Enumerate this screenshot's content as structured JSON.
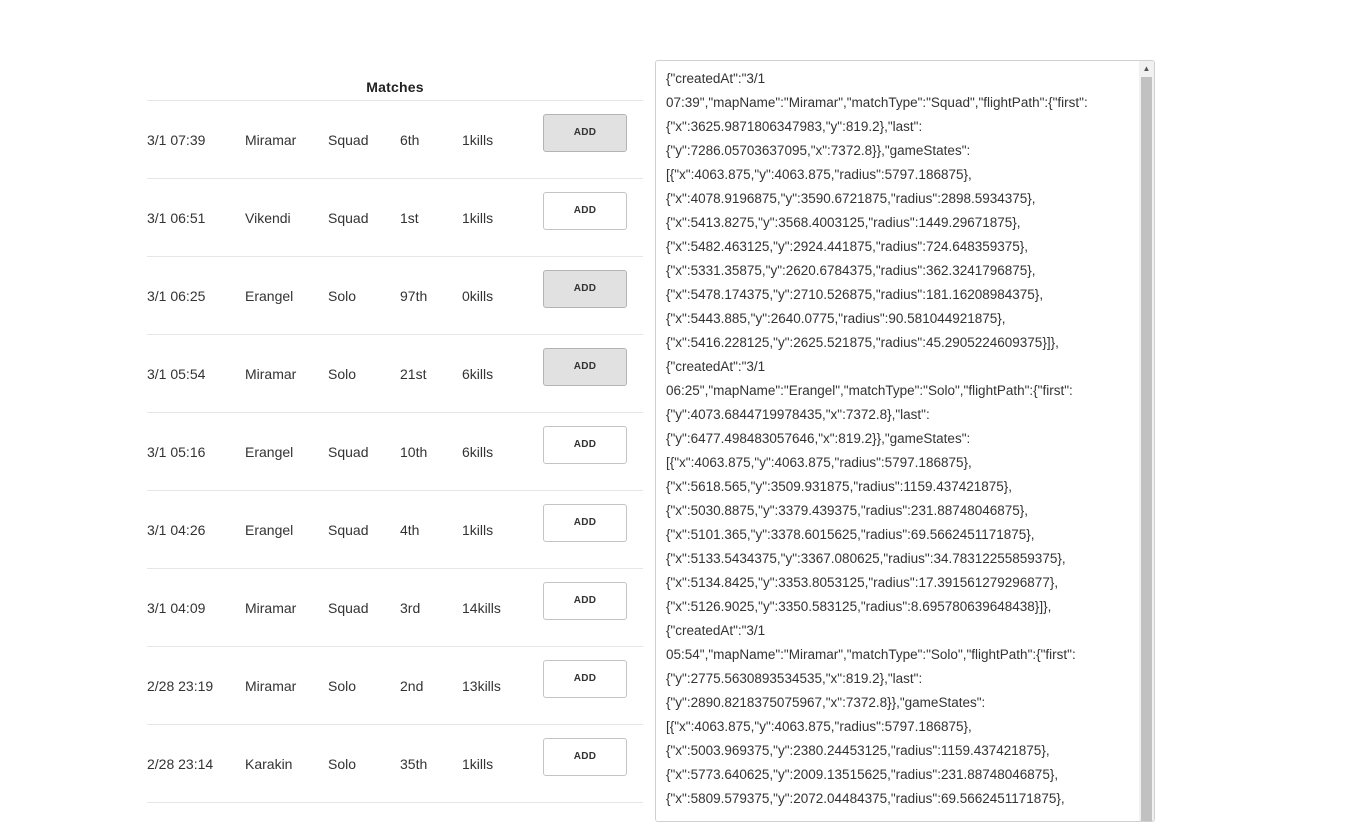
{
  "matches": {
    "title": "Matches",
    "add_label": "ADD",
    "rows": [
      {
        "date": "3/1 07:39",
        "map": "Miramar",
        "type": "Squad",
        "place": "6th",
        "kills": "1kills",
        "active": true
      },
      {
        "date": "3/1 06:51",
        "map": "Vikendi",
        "type": "Squad",
        "place": "1st",
        "kills": "1kills",
        "active": false
      },
      {
        "date": "3/1 06:25",
        "map": "Erangel",
        "type": "Solo",
        "place": "97th",
        "kills": "0kills",
        "active": true
      },
      {
        "date": "3/1 05:54",
        "map": "Miramar",
        "type": "Solo",
        "place": "21st",
        "kills": "6kills",
        "active": true
      },
      {
        "date": "3/1 05:16",
        "map": "Erangel",
        "type": "Squad",
        "place": "10th",
        "kills": "6kills",
        "active": false
      },
      {
        "date": "3/1 04:26",
        "map": "Erangel",
        "type": "Squad",
        "place": "4th",
        "kills": "1kills",
        "active": false
      },
      {
        "date": "3/1 04:09",
        "map": "Miramar",
        "type": "Squad",
        "place": "3rd",
        "kills": "14kills",
        "active": false
      },
      {
        "date": "2/28 23:19",
        "map": "Miramar",
        "type": "Solo",
        "place": "2nd",
        "kills": "13kills",
        "active": false
      },
      {
        "date": "2/28 23:14",
        "map": "Karakin",
        "type": "Solo",
        "place": "35th",
        "kills": "1kills",
        "active": false
      }
    ]
  },
  "json_output": {
    "lines": [
      "{\"createdAt\":\"3/1",
      "07:39\",\"mapName\":\"Miramar\",\"matchType\":\"Squad\",\"flightPath\":{\"first\":",
      "{\"x\":3625.9871806347983,\"y\":819.2},\"last\":",
      "{\"y\":7286.05703637095,\"x\":7372.8}},\"gameStates\":",
      "[{\"x\":4063.875,\"y\":4063.875,\"radius\":5797.186875},",
      "{\"x\":4078.9196875,\"y\":3590.6721875,\"radius\":2898.5934375},",
      "{\"x\":5413.8275,\"y\":3568.4003125,\"radius\":1449.29671875},",
      "{\"x\":5482.463125,\"y\":2924.441875,\"radius\":724.648359375},",
      "{\"x\":5331.35875,\"y\":2620.6784375,\"radius\":362.3241796875},",
      "{\"x\":5478.174375,\"y\":2710.526875,\"radius\":181.16208984375},",
      "{\"x\":5443.885,\"y\":2640.0775,\"radius\":90.581044921875},",
      "{\"x\":5416.228125,\"y\":2625.521875,\"radius\":45.2905224609375}]},",
      "{\"createdAt\":\"3/1",
      "06:25\",\"mapName\":\"Erangel\",\"matchType\":\"Solo\",\"flightPath\":{\"first\":",
      "{\"y\":4073.6844719978435,\"x\":7372.8},\"last\":",
      "{\"y\":6477.498483057646,\"x\":819.2}},\"gameStates\":",
      "[{\"x\":4063.875,\"y\":4063.875,\"radius\":5797.186875},",
      "{\"x\":5618.565,\"y\":3509.931875,\"radius\":1159.437421875},",
      "{\"x\":5030.8875,\"y\":3379.439375,\"radius\":231.88748046875},",
      "{\"x\":5101.365,\"y\":3378.6015625,\"radius\":69.5662451171875},",
      "{\"x\":5133.5434375,\"y\":3367.080625,\"radius\":34.78312255859375},",
      "{\"x\":5134.8425,\"y\":3353.8053125,\"radius\":17.391561279296877},",
      "{\"x\":5126.9025,\"y\":3350.583125,\"radius\":8.695780639648438}]},",
      "{\"createdAt\":\"3/1",
      "05:54\",\"mapName\":\"Miramar\",\"matchType\":\"Solo\",\"flightPath\":{\"first\":",
      "{\"y\":2775.5630893534535,\"x\":819.2},\"last\":",
      "{\"y\":2890.8218375075967,\"x\":7372.8}},\"gameStates\":",
      "[{\"x\":4063.875,\"y\":4063.875,\"radius\":5797.186875},",
      "{\"x\":5003.969375,\"y\":2380.24453125,\"radius\":1159.437421875},",
      "{\"x\":5773.640625,\"y\":2009.13515625,\"radius\":231.88748046875},",
      "{\"x\":5809.579375,\"y\":2072.04484375,\"radius\":69.5662451171875},"
    ]
  }
}
